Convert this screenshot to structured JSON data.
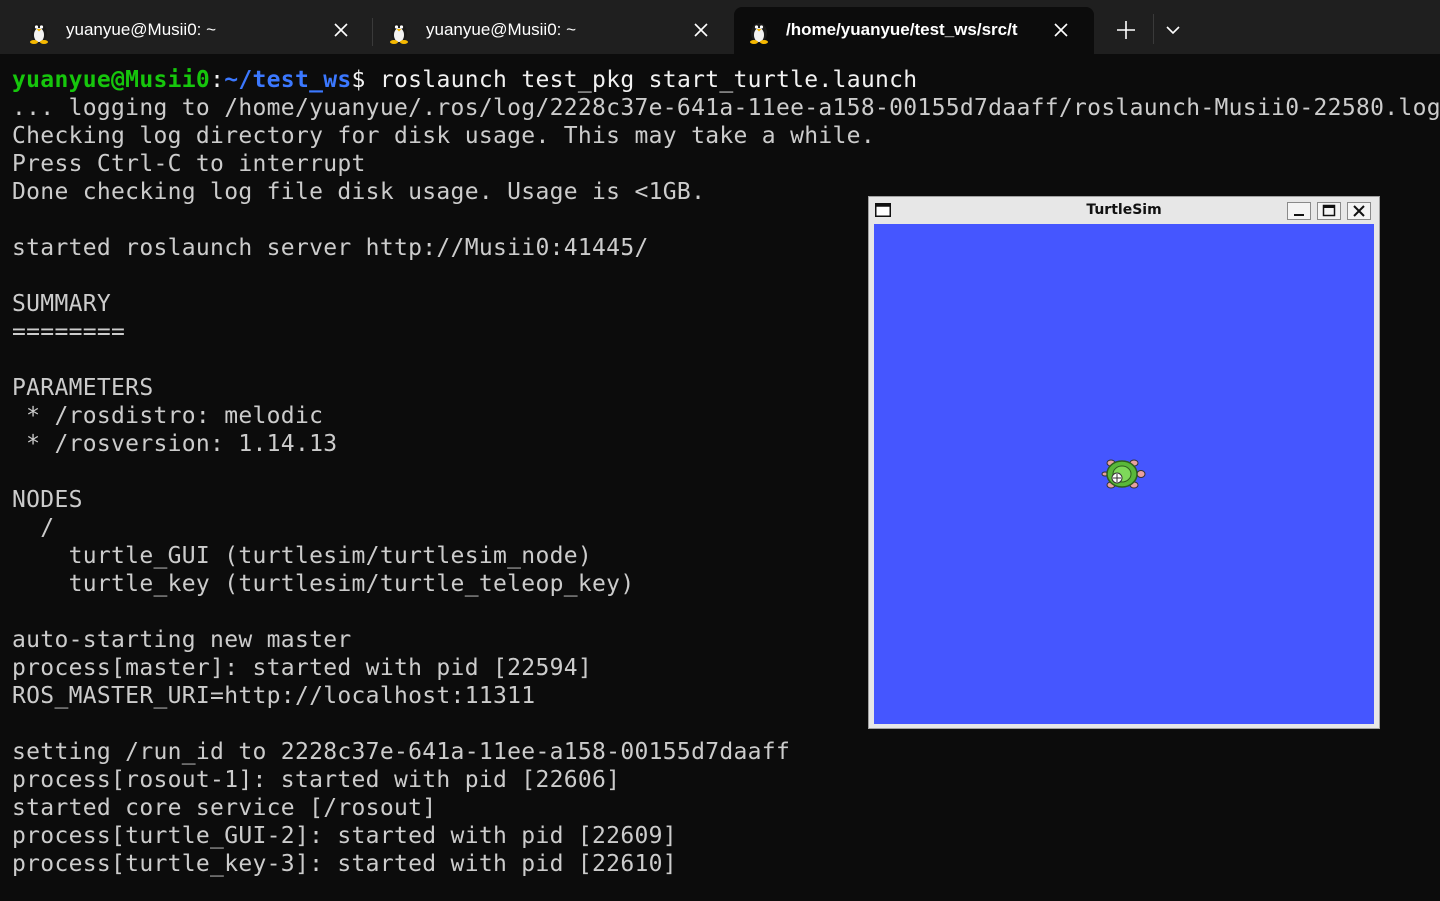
{
  "tabs": [
    {
      "title": "yuanyue@Musii0: ~",
      "icon": "tux-icon",
      "active": false
    },
    {
      "title": "yuanyue@Musii0: ~",
      "icon": "tux-icon",
      "active": false
    },
    {
      "title": "/home/yuanyue/test_ws/src/t",
      "icon": "tux-icon",
      "active": true
    }
  ],
  "prompt": {
    "user_host": "yuanyue@Musii0",
    "separator": ":",
    "path": "~/test_ws",
    "symbol": "$",
    "command": " roslaunch test_pkg start_turtle.launch"
  },
  "output_lines": [
    "... logging to /home/yuanyue/.ros/log/2228c37e-641a-11ee-a158-00155d7daaff/roslaunch-Musii0-22580.log",
    "Checking log directory for disk usage. This may take a while.",
    "Press Ctrl-C to interrupt",
    "Done checking log file disk usage. Usage is <1GB.",
    "",
    "started roslaunch server http://Musii0:41445/",
    "",
    "SUMMARY",
    "========",
    "",
    "PARAMETERS",
    " * /rosdistro: melodic",
    " * /rosversion: 1.14.13",
    "",
    "NODES",
    "  /",
    "    turtle_GUI (turtlesim/turtlesim_node)",
    "    turtle_key (turtlesim/turtle_teleop_key)",
    "",
    "auto-starting new master",
    "process[master]: started with pid [22594]",
    "ROS_MASTER_URI=http://localhost:11311",
    "",
    "setting /run_id to 2228c37e-641a-11ee-a158-00155d7daaff",
    "process[rosout-1]: started with pid [22606]",
    "started core service [/rosout]",
    "process[turtle_GUI-2]: started with pid [22609]",
    "process[turtle_key-3]: started with pid [22610]"
  ],
  "turtlesim": {
    "title": "TurtleSim",
    "background_color": "#4556ff"
  },
  "colors": {
    "prompt_user": "#16c60c",
    "prompt_path": "#3b78ff",
    "terminal_bg": "#0c0c0c",
    "tab_bar_bg": "#1f1f1f"
  }
}
